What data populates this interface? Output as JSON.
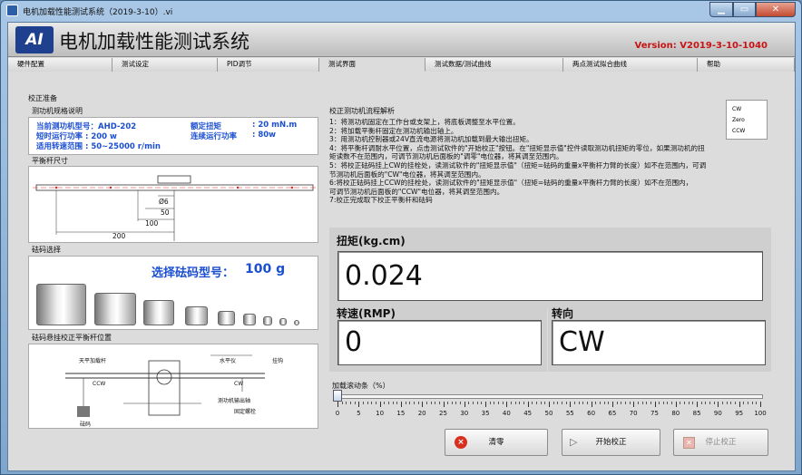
{
  "window": {
    "title": "电机加载性能测试系统（2019-3-10）.vi"
  },
  "header": {
    "title": "电机加载性能测试系统",
    "version": "Version: V2019-3-10-1040"
  },
  "tabs": [
    "硬件配置",
    "测试设定",
    "PID调节",
    "测试界面",
    "测试数据/测试曲线",
    "两点测试拟合曲线",
    "帮助"
  ],
  "calibration": {
    "section_label": "校正准备",
    "spec_label": "测功机规格说明",
    "model": "当前测功机型号：AHD-202",
    "rated_torque_label": "额定扭矩",
    "rated_torque_value": ": 20 mN.m",
    "short_power": "短时运行功率  : 200 w",
    "cont_power_label": "连续运行功率",
    "cont_power_value": ": 80w",
    "speed_range": "适用转速范围  : 50~25000 r/min",
    "bar_label": "平衡杆尺寸",
    "dims": [
      "Ø6",
      "50",
      "100",
      "200"
    ],
    "weight_select_label": "砝码选择",
    "weight_select_text": "选择砝码型号：",
    "weight_value": "100 g",
    "hang_label": "砝码悬挂校正平衡杆位置",
    "diagram_labels": [
      "天平加载杆",
      "水平仪",
      "挂钩",
      "CCW",
      "CW",
      "测功机输出轴",
      "固定螺栓",
      "砝码"
    ]
  },
  "procedure": {
    "title": "校正测功机流程解析",
    "steps": [
      "1：将测功机固定在工作台或支架上，将底板调整至水平位置。",
      "2：将加载平衡杆固定在测功机输出轴上。",
      "3：用测功机控制器或24V直流电源将测功机加载到最大输出扭矩。",
      "4：将平衡杆调耐水平位置，点击测试软件的\"开始校正\"按钮。在\"扭矩显示值\"控件读取测功机扭矩的零位，如果测功机的扭",
      "矩读数不在范围内，可调节测功机后面板的\"调零\"电位器，将其调至范围内。",
      "5：将校正砝码挂上CW的挂栓处，读测试软件的\"扭矩显示值\"（扭矩=砝码的重量x平衡杆力臂的长度）如不在范围内，可调",
      "节测功机后面板的\"CW\"电位器，将其调至范围内。",
      "6:将校正砝码挂上CCW的挂栓处，读测试软件的\"扭矩显示值\"（扭矩=砝码的重量x平衡杆力臂的长度）如不在范围内，",
      "可调节测功机后面板的\"CCW\"电位器，将其调至范围内。",
      "7:校正完成取下校正平衡杆和砝码"
    ],
    "legend": [
      "CW",
      "Zero",
      "CCW"
    ]
  },
  "readouts": {
    "torque_label": "扭矩(kg.cm)",
    "torque_value": "0.024",
    "speed_label": "转速(RMP)",
    "speed_value": "0",
    "direction_label": "转向",
    "direction_value": "CW"
  },
  "slider": {
    "label": "加载滚动条（%）",
    "value": 0,
    "ticks": [
      "0",
      "5",
      "10",
      "15",
      "20",
      "25",
      "30",
      "35",
      "40",
      "45",
      "50",
      "55",
      "60",
      "65",
      "70",
      "75",
      "80",
      "85",
      "90",
      "95",
      "100"
    ]
  },
  "buttons": {
    "clear": "清零",
    "start": "开始校正",
    "stop": "停止校正"
  }
}
